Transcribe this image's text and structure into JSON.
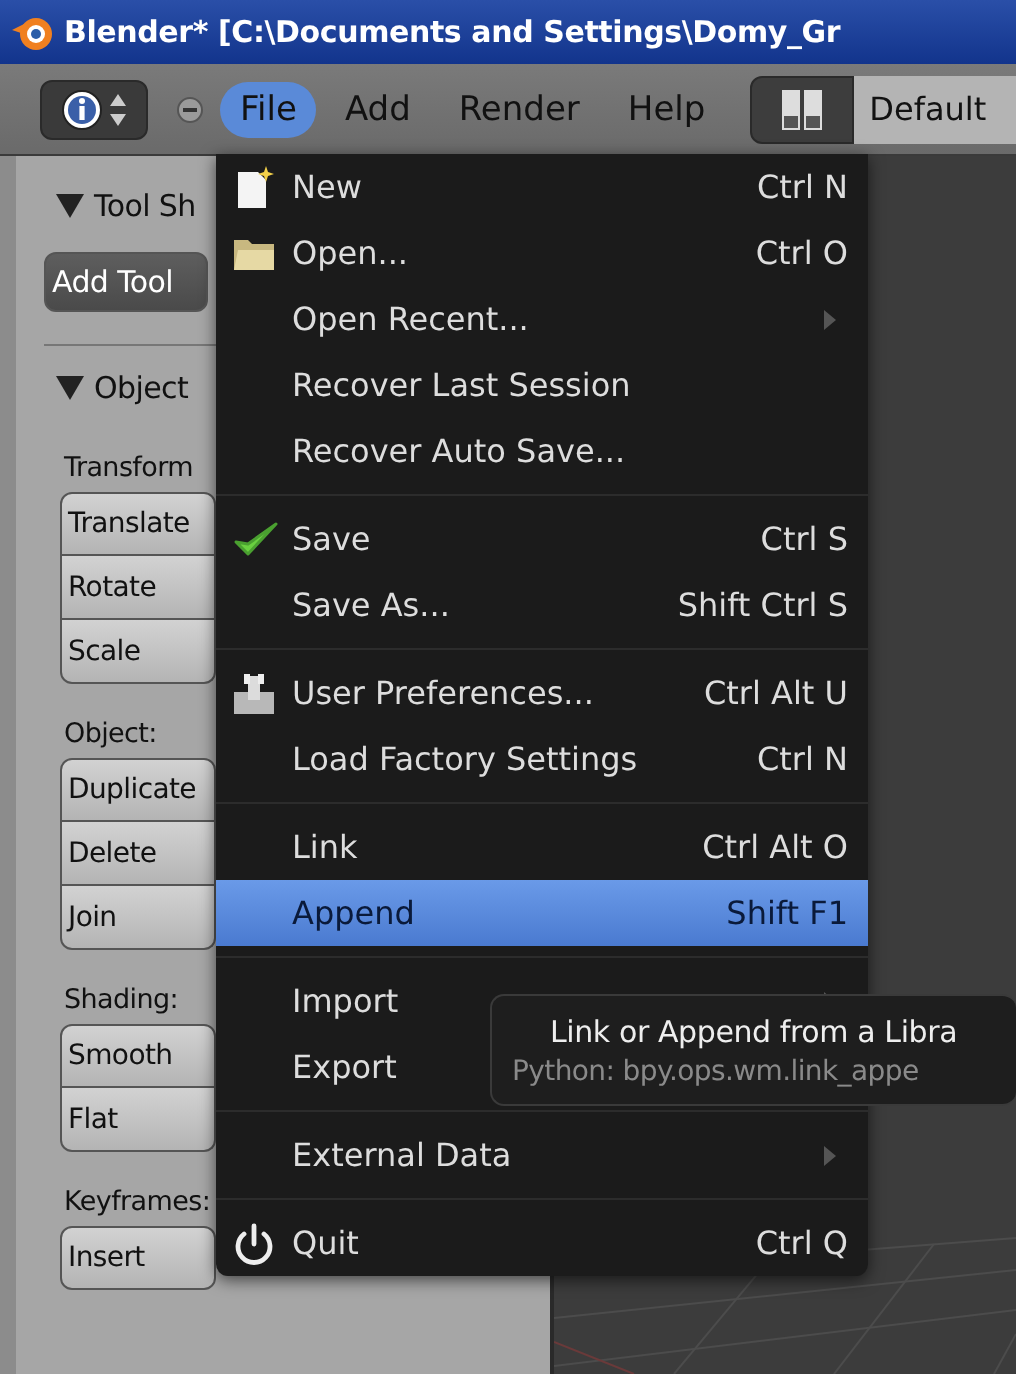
{
  "window": {
    "title": "Blender* [C:\\Documents and Settings\\Domy_Gr"
  },
  "header": {
    "menus": [
      {
        "label": "File",
        "selected": true
      },
      {
        "label": "Add",
        "selected": false
      },
      {
        "label": "Render",
        "selected": false
      },
      {
        "label": "Help",
        "selected": false
      }
    ],
    "screen_layout": "Default"
  },
  "tool_shelf": {
    "panels": [
      {
        "title": "Tool Sh",
        "expanded": true,
        "items": [
          {
            "kind": "button",
            "labels": [
              "Add Tool"
            ]
          }
        ]
      },
      {
        "title": "Object",
        "expanded": true,
        "items": [
          {
            "kind": "label",
            "labels": [
              "Transform"
            ]
          },
          {
            "kind": "buttons",
            "labels": [
              "Translate",
              "Rotate",
              "Scale"
            ]
          },
          {
            "kind": "label",
            "labels": [
              "Object:"
            ]
          },
          {
            "kind": "buttons",
            "labels": [
              "Duplicate",
              "Delete",
              "Join"
            ]
          },
          {
            "kind": "label",
            "labels": [
              "Shading:"
            ]
          },
          {
            "kind": "buttons",
            "labels": [
              "Smooth",
              "Flat"
            ]
          },
          {
            "kind": "label",
            "labels": [
              "Keyframes:"
            ]
          },
          {
            "kind": "buttons",
            "labels": [
              "Insert"
            ]
          }
        ]
      }
    ]
  },
  "file_menu": {
    "sections": [
      {
        "items": [
          {
            "label": "New",
            "shortcut": "Ctrl N",
            "submenu": false,
            "selected": false
          },
          {
            "label": "Open...",
            "shortcut": "Ctrl O",
            "submenu": false,
            "selected": false
          },
          {
            "label": "Open Recent...",
            "submenu": true,
            "selected": false
          },
          {
            "label": "Recover Last Session",
            "submenu": false,
            "selected": false
          },
          {
            "label": "Recover Auto Save...",
            "submenu": false,
            "selected": false
          }
        ]
      },
      {
        "items": [
          {
            "label": "Save",
            "shortcut": "Ctrl S",
            "submenu": false,
            "selected": false
          },
          {
            "label": "Save As...",
            "shortcut": "Shift Ctrl S",
            "submenu": false,
            "selected": false
          }
        ]
      },
      {
        "items": [
          {
            "label": "User Preferences...",
            "shortcut": "Ctrl Alt U",
            "submenu": false,
            "selected": false
          },
          {
            "label": "Load Factory Settings",
            "shortcut": "Ctrl N",
            "submenu": false,
            "selected": false
          }
        ]
      },
      {
        "items": [
          {
            "label": "Link",
            "shortcut": "Ctrl Alt O",
            "submenu": false,
            "selected": false
          },
          {
            "label": "Append",
            "shortcut": "Shift F1",
            "submenu": false,
            "selected": true
          }
        ]
      },
      {
        "items": [
          {
            "label": "Import",
            "submenu": true,
            "selected": false
          },
          {
            "label": "Export",
            "submenu": false,
            "selected": false
          }
        ]
      },
      {
        "items": [
          {
            "label": "External Data",
            "submenu": true,
            "selected": false
          }
        ]
      },
      {
        "items": [
          {
            "label": "Quit",
            "shortcut": "Ctrl Q",
            "submenu": false,
            "selected": false
          }
        ]
      }
    ]
  },
  "tooltip": {
    "title": "Link or Append from a Libra",
    "python": "Python: bpy.ops.wm.link_appe"
  }
}
